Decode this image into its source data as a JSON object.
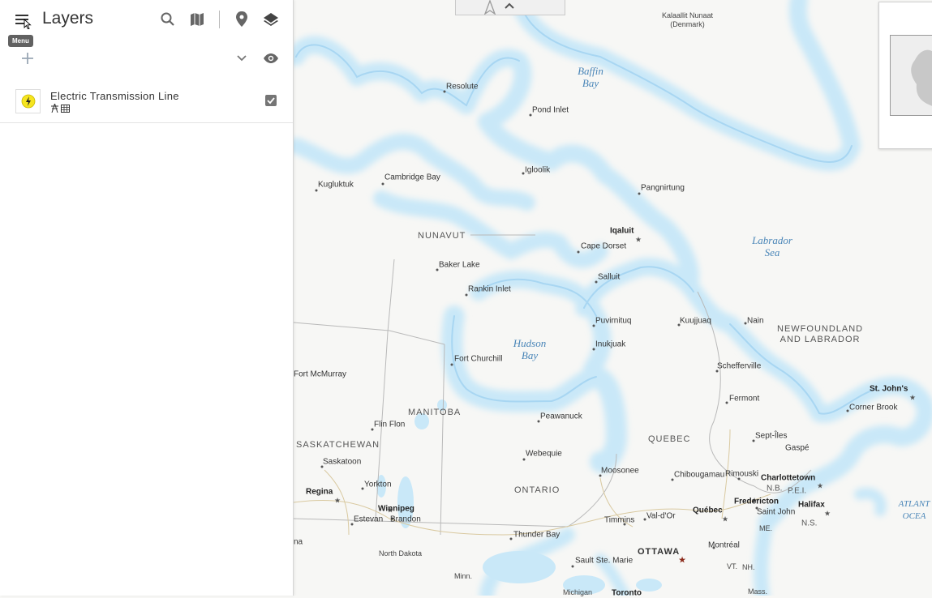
{
  "panel": {
    "title": "Layers",
    "menu_tooltip": "Menu",
    "layer": {
      "name": "Electric Transmission Line",
      "checked": true
    }
  },
  "icons": {
    "menu": "hamburger-menu-icon",
    "search": "search-icon",
    "basemap": "map-icon",
    "location": "location-pin-icon",
    "layers": "layers-icon",
    "add": "plus-icon",
    "expand": "chevron-down-icon",
    "visibility": "eye-icon",
    "checkbox": "checkbox-checked-icon",
    "compass": "compass-north-icon",
    "collapse": "chevron-up-icon"
  },
  "colors": {
    "water": "#c9e8f8",
    "water_edge": "#a8d6f2",
    "land": "#f7f7f5",
    "layer_symbol": "#f6e51f"
  },
  "map": {
    "water_labels": [
      {
        "id": "baffin-bay",
        "text": "Baffin\nBay"
      },
      {
        "id": "labrador-sea",
        "text": "Labrador\nSea"
      },
      {
        "id": "hudson-bay",
        "text": "Hudson\nBay"
      },
      {
        "id": "atlantic",
        "text": "ATLANT\nOCEA"
      }
    ],
    "region_labels": [
      {
        "id": "nunavut",
        "text": "NUNAVUT"
      },
      {
        "id": "manitoba",
        "text": "MANITOBA"
      },
      {
        "id": "saskatchewan",
        "text": "SASKATCHEWAN"
      },
      {
        "id": "ontario",
        "text": "ONTARIO"
      },
      {
        "id": "quebec",
        "text": "QUEBEC"
      },
      {
        "id": "nl",
        "text": "NEWFOUNDLAND\nAND LABRADOR"
      },
      {
        "id": "greenland",
        "text": "Kalaallit Nunaat\n(Denmark)"
      },
      {
        "id": "nb",
        "text": "N.B."
      },
      {
        "id": "pei",
        "text": "P.E.I."
      },
      {
        "id": "ns",
        "text": "N.S."
      },
      {
        "id": "me",
        "text": "ME."
      },
      {
        "id": "vt",
        "text": "VT."
      },
      {
        "id": "nh",
        "text": "NH."
      },
      {
        "id": "north-dakota",
        "text": "North Dakota"
      },
      {
        "id": "minn",
        "text": "Minn."
      },
      {
        "id": "michigan",
        "text": "Michigan"
      },
      {
        "id": "mass",
        "text": "Mass."
      }
    ],
    "cities": [
      {
        "id": "resolute",
        "text": "Resolute"
      },
      {
        "id": "pond-inlet",
        "text": "Pond Inlet"
      },
      {
        "id": "igloolik",
        "text": "Igloolik"
      },
      {
        "id": "pangnirtung",
        "text": "Pangnirtung"
      },
      {
        "id": "kugluktuk",
        "text": "Kugluktuk"
      },
      {
        "id": "cambridge-bay",
        "text": "Cambridge Bay"
      },
      {
        "id": "iqaluit",
        "text": "Iqaluit"
      },
      {
        "id": "cape-dorset",
        "text": "Cape Dorset"
      },
      {
        "id": "baker-lake",
        "text": "Baker Lake"
      },
      {
        "id": "rankin-inlet",
        "text": "Rankin Inlet"
      },
      {
        "id": "salluit",
        "text": "Salluit"
      },
      {
        "id": "puvirnituq",
        "text": "Puvirnituq"
      },
      {
        "id": "kuujjuaq",
        "text": "Kuujjuaq"
      },
      {
        "id": "nain",
        "text": "Nain"
      },
      {
        "id": "inukjuak",
        "text": "Inukjuak"
      },
      {
        "id": "fort-churchill",
        "text": "Fort Churchill"
      },
      {
        "id": "fort-mcmurray",
        "text": "Fort McMurray"
      },
      {
        "id": "schefferville",
        "text": "Schefferville"
      },
      {
        "id": "st-johns",
        "text": "St. John's"
      },
      {
        "id": "fermont",
        "text": "Fermont"
      },
      {
        "id": "corner-brook",
        "text": "Corner Brook"
      },
      {
        "id": "peawanuck",
        "text": "Peawanuck"
      },
      {
        "id": "flin-flon",
        "text": "Flin Flon"
      },
      {
        "id": "sept-iles",
        "text": "Sept-Îles"
      },
      {
        "id": "gaspe",
        "text": "Gaspé"
      },
      {
        "id": "webequie",
        "text": "Webequie"
      },
      {
        "id": "saskatoon",
        "text": "Saskatoon"
      },
      {
        "id": "moosonee",
        "text": "Moosonee"
      },
      {
        "id": "chibougamau",
        "text": "Chibougamau"
      },
      {
        "id": "rimouski",
        "text": "Rimouski"
      },
      {
        "id": "charlottetown",
        "text": "Charlottetown"
      },
      {
        "id": "yorkton",
        "text": "Yorkton"
      },
      {
        "id": "regina",
        "text": "Regina"
      },
      {
        "id": "winnipeg",
        "text": "Winnipeg"
      },
      {
        "id": "estevan",
        "text": "Estevan"
      },
      {
        "id": "brandon",
        "text": "Brandon"
      },
      {
        "id": "fredericton",
        "text": "Fredericton"
      },
      {
        "id": "saint-john",
        "text": "Saint John"
      },
      {
        "id": "halifax",
        "text": "Halifax"
      },
      {
        "id": "quebec-city",
        "text": "Québec"
      },
      {
        "id": "timmins",
        "text": "Timmins"
      },
      {
        "id": "val-dor",
        "text": "Val-d'Or"
      },
      {
        "id": "thunder-bay",
        "text": "Thunder Bay"
      },
      {
        "id": "ottawa",
        "text": "OTTAWA"
      },
      {
        "id": "montreal",
        "text": "Montréal"
      },
      {
        "id": "sault-ste-marie",
        "text": "Sault Ste. Marie"
      },
      {
        "id": "toronto",
        "text": "Toronto"
      },
      {
        "id": "na-edge",
        "text": "na"
      }
    ]
  }
}
